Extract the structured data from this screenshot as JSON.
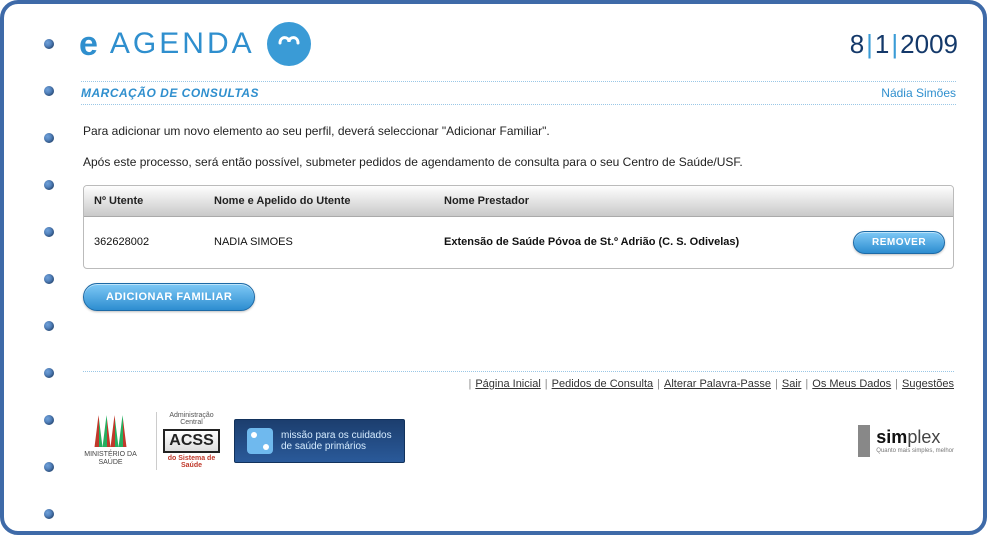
{
  "logo": {
    "e": "e",
    "text": "AGENDA"
  },
  "date": {
    "day": "8",
    "month": "1",
    "year": "2009"
  },
  "section": {
    "title": "MARCAÇÃO DE CONSULTAS",
    "user": "Nádia Simões"
  },
  "intro": {
    "line1": "Para adicionar um novo elemento ao seu perfil, deverá seleccionar \"Adicionar Familiar\".",
    "line2": "Após este processo, será então possível, submeter pedidos de agendamento de consulta para o seu Centro de Saúde/USF."
  },
  "table": {
    "headers": {
      "utente": "Nº Utente",
      "nome": "Nome e Apelido do Utente",
      "prestador": "Nome Prestador"
    },
    "rows": [
      {
        "utente": "362628002",
        "nome": "NADIA SIMOES",
        "prestador": "Extensão de Saúde Póvoa de St.º Adrião (C. S. Odivelas)"
      }
    ],
    "remove_label": "REMOVER"
  },
  "buttons": {
    "add_familiar": "ADICIONAR FAMILIAR"
  },
  "footer_nav": [
    "Página Inicial",
    "Pedidos de Consulta",
    "Alterar Palavra-Passe",
    "Sair",
    "Os Meus Dados",
    "Sugestões"
  ],
  "footer_logos": {
    "ministerio": "MINISTÉRIO DA SAÚDE",
    "acss_top": "Administração Central",
    "acss_main": "ACSS",
    "acss_sub": "do Sistema de Saúde",
    "mcsp_line1": "missão para os cuidados",
    "mcsp_line2": "de saúde primários",
    "simplex": "simplex",
    "simplex_sub": "Quanto mais simples, melhor"
  }
}
